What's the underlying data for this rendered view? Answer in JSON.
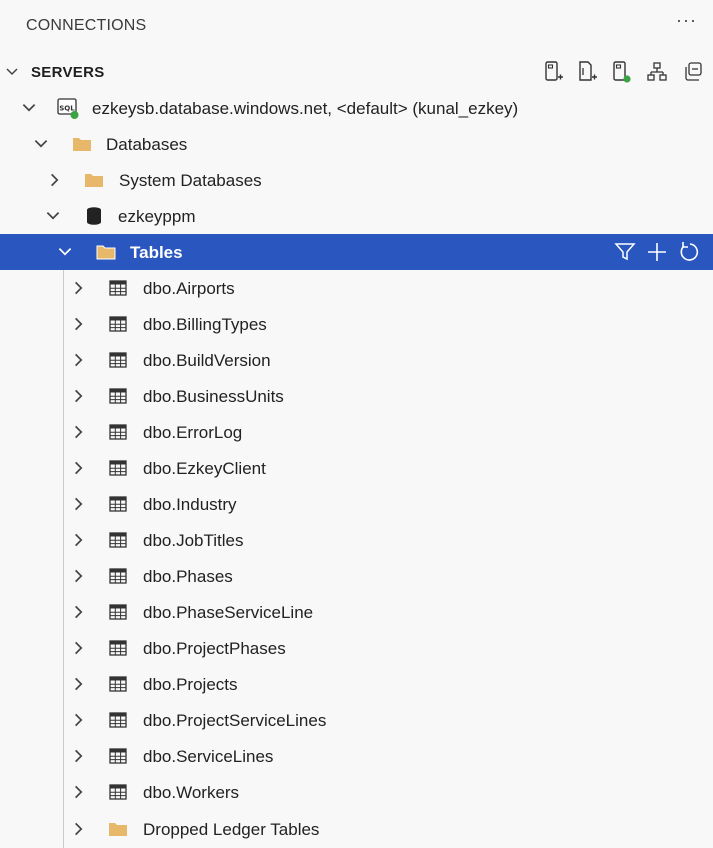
{
  "header": {
    "title": "CONNECTIONS",
    "more": "···"
  },
  "servers_section": {
    "label": "SERVERS"
  },
  "server": {
    "label": "ezkeysb.database.windows.net, <default> (kunal_ezkey)",
    "status_color": "#3ba343"
  },
  "databases_folder": {
    "label": "Databases"
  },
  "system_databases": {
    "label": "System Databases"
  },
  "database": {
    "label": "ezkeyppm"
  },
  "tables_folder": {
    "label": "Tables"
  },
  "tables": [
    "dbo.Airports",
    "dbo.BillingTypes",
    "dbo.BuildVersion",
    "dbo.BusinessUnits",
    "dbo.ErrorLog",
    "dbo.EzkeyClient",
    "dbo.Industry",
    "dbo.JobTitles",
    "dbo.Phases",
    "dbo.PhaseServiceLine",
    "dbo.ProjectPhases",
    "dbo.Projects",
    "dbo.ProjectServiceLines",
    "dbo.ServiceLines",
    "dbo.Workers"
  ],
  "dropped_ledger": {
    "label": "Dropped Ledger Tables"
  },
  "colors": {
    "selection": "#2a56c0",
    "folder": "#e8b86a",
    "status_green": "#3ba343"
  }
}
